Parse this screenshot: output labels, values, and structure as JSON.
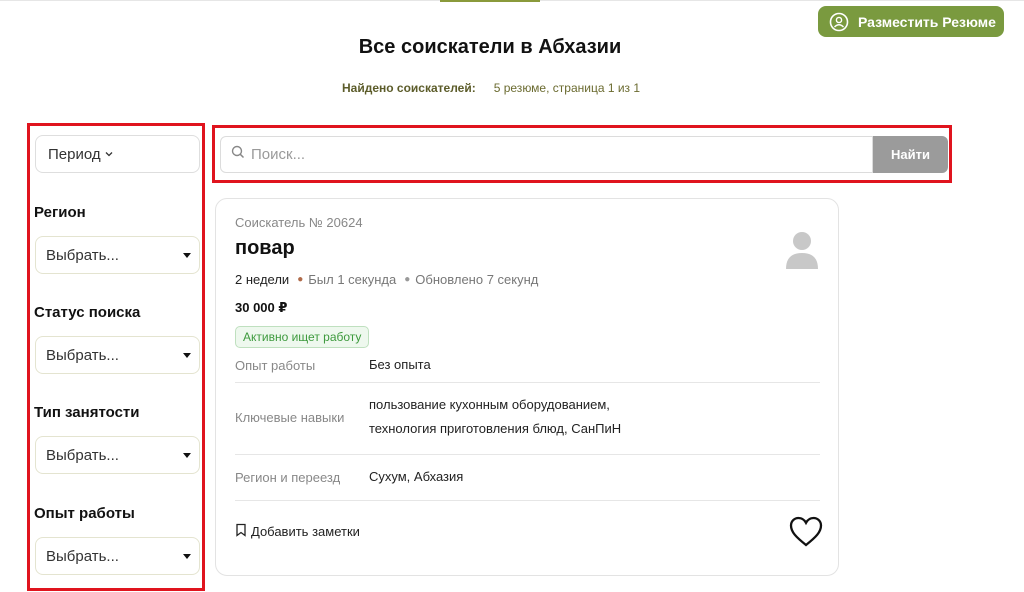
{
  "header": {
    "post_button_label": "Разместить Резюме",
    "title": "Все соискатели в Абхазии",
    "found_label": "Найдено соискателей:",
    "found_value": "5 резюме, страница 1 из 1"
  },
  "sidebar": {
    "period_label": "Период",
    "filters": [
      {
        "label": "Регион",
        "value": "Выбрать..."
      },
      {
        "label": "Статус поиска",
        "value": "Выбрать..."
      },
      {
        "label": "Тип занятости",
        "value": "Выбрать..."
      },
      {
        "label": "Опыт работы",
        "value": "Выбрать..."
      }
    ]
  },
  "search": {
    "placeholder": "Поиск...",
    "button_label": "Найти"
  },
  "card": {
    "number": "Соискатель № 20624",
    "job_title": "повар",
    "duration": "2 недели",
    "last_seen": "Был 1 секунда",
    "updated": "Обновлено 7 секунд",
    "salary": "30 000 ₽",
    "status_badge": "Активно ищет работу",
    "rows": [
      {
        "label": "Опыт работы",
        "value": "Без опыта"
      },
      {
        "label": "Ключевые навыки",
        "value_line1": "пользование кухонным оборудованием,",
        "value_line2": "технология приготовления блюд, СанПиН"
      },
      {
        "label": "Регион и переезд",
        "value": "Сухум, Абхазия"
      }
    ],
    "notes_label": "Добавить заметки"
  },
  "colors": {
    "brand_green": "#7a9a3f",
    "highlight_red": "#e0141e",
    "search_button": "#9b9b9b",
    "badge_green": "#3d9a3d"
  }
}
